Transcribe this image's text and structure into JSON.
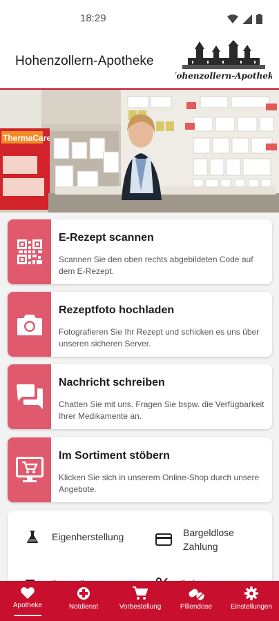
{
  "status_bar": {
    "time": "18:29"
  },
  "header": {
    "title": "Hohenzollern-Apotheke",
    "logo_text": "Hohenzollern-Apotheke"
  },
  "hero": {
    "banner_text": "ThermaCare"
  },
  "actions": [
    {
      "title": "E-Rezept scannen",
      "description": "Scannen Sie den oben rechts abgebildeten Code auf dem E-Rezept.",
      "icon": "qr-code-icon"
    },
    {
      "title": "Rezeptfoto hochladen",
      "description": "Fotografieren Sie Ihr Rezept und schicken es uns über unseren sicheren Server.",
      "icon": "camera-icon"
    },
    {
      "title": "Nachricht schreiben",
      "description": "Chatten Sie mit uns. Fragen Sie bspw. die Verfügbarkeit Ihrer Medikamente an.",
      "icon": "chat-icon"
    },
    {
      "title": "Im Sortiment stöbern",
      "description": "Klicken Sie sich in unserem Online-Shop durch unsere Angebote.",
      "icon": "shop-monitor-icon"
    }
  ],
  "features": [
    {
      "label": "Eigenherstellung",
      "icon": "flask-icon"
    },
    {
      "label": "Bargeldlose Zahlung",
      "icon": "credit-card-icon"
    },
    {
      "label": "Botendienst",
      "icon": "truck-icon"
    },
    {
      "label": "Rabatt",
      "icon": "percent-icon"
    }
  ],
  "bottom_nav": [
    {
      "label": "Apotheke",
      "icon": "heart-icon",
      "active": true
    },
    {
      "label": "Notdienst",
      "icon": "emergency-icon",
      "active": false
    },
    {
      "label": "Vorbestellung",
      "icon": "cart-icon",
      "active": false
    },
    {
      "label": "Pillendose",
      "icon": "pills-icon",
      "active": false
    },
    {
      "label": "Einstellungen",
      "icon": "gear-icon",
      "active": false
    }
  ],
  "colors": {
    "brand_red": "#c8102e",
    "icon_pink": "#e05a6d"
  }
}
